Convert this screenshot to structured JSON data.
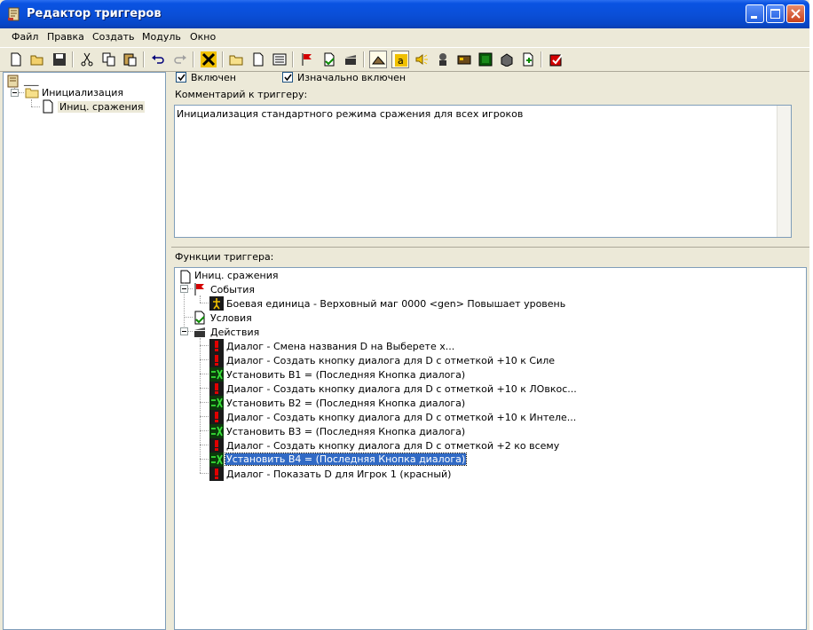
{
  "window": {
    "title": "Редактор триггеров"
  },
  "menu": [
    "Файл",
    "Правка",
    "Создать",
    "Модуль",
    "Окно"
  ],
  "toolbar_icons": [
    "new-icon",
    "open-icon",
    "save-icon",
    "cut-icon",
    "copy-icon",
    "paste-icon",
    "undo-icon",
    "redo-icon",
    "trigger-x-icon",
    "folder-icon",
    "new-trigger-icon",
    "comment-icon",
    "event-flag-icon",
    "condition-icon",
    "action-icon",
    "terrain-icon",
    "text-icon",
    "sound-icon",
    "unit-icon",
    "object-icon",
    "minimap-icon",
    "import-icon",
    "ai-icon",
    "test-map-icon"
  ],
  "left_tree": {
    "root_label": "___",
    "folder_label": "Инициализация",
    "trigger_label": "Иниц. сражения"
  },
  "checks": {
    "enabled_label": "Включен",
    "enabled": true,
    "initially_on_label": "Изначально включен",
    "initially_on": true
  },
  "comment": {
    "label": "Комментарий к триггеру:",
    "text": "Инициализация стандартного режима сражения для всех игроков"
  },
  "functions": {
    "label": "Функции триггера:",
    "root": "Иниц. сражения",
    "events_label": "События",
    "events": [
      "Боевая единица - Верховный маг 0000 <gen> Повышает уровень"
    ],
    "conditions_label": "Условия",
    "actions_label": "Действия",
    "actions": [
      {
        "icon": "dialog",
        "text": "Диалог - Смена названия D на Выберете х..."
      },
      {
        "icon": "dialog",
        "text": "Диалог - Создать кнопку диалога для D с отметкой +10 к Силе"
      },
      {
        "icon": "set",
        "text": "Установить B1 = (Последняя Кнопка диалога)"
      },
      {
        "icon": "dialog",
        "text": "Диалог - Создать кнопку диалога для D с отметкой +10 к ЛОвкос..."
      },
      {
        "icon": "set",
        "text": "Установить B2 = (Последняя Кнопка диалога)"
      },
      {
        "icon": "dialog",
        "text": "Диалог - Создать кнопку диалога для D с отметкой +10 к Интеле..."
      },
      {
        "icon": "set",
        "text": "Установить B3 = (Последняя Кнопка диалога)"
      },
      {
        "icon": "dialog",
        "text": "Диалог - Создать кнопку диалога для D с отметкой +2 ко всему"
      },
      {
        "icon": "set",
        "text": "Установить B4 = (Последняя Кнопка диалога)",
        "selected": true
      },
      {
        "icon": "dialog",
        "text": "Диалог - Показать D для Игрок 1 (красный)"
      }
    ]
  }
}
